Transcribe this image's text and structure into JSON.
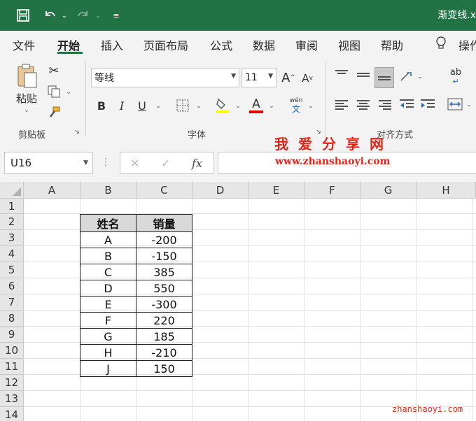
{
  "title_bar": {
    "file_title": "渐变线.x"
  },
  "tabs": [
    "文件",
    "开始",
    "插入",
    "页面布局",
    "公式",
    "数据",
    "审阅",
    "视图",
    "帮助",
    "操作"
  ],
  "active_tab": "开始",
  "ribbon": {
    "clipboard": {
      "paste_label": "粘贴",
      "group_label": "剪贴板"
    },
    "font": {
      "font_name": "等线",
      "font_size": "11",
      "bold": "B",
      "italic": "I",
      "underline": "U",
      "font_color_glyph": "A",
      "phonetic_top": "wén",
      "phonetic_bottom": "文",
      "grow": "A",
      "shrink": "A",
      "group_label": "字体"
    },
    "alignment": {
      "group_label": "对齐方式",
      "wrap_glyph": "ab"
    },
    "colors": {
      "fill_color": "#ffff00",
      "font_color": "#e00000"
    }
  },
  "formula_bar": {
    "name_box": "U16",
    "fx": "fx"
  },
  "watermark": {
    "title": "我爱分享网",
    "url": "www.zhanshaoyi.com",
    "corner": "zhanshaoyi.com"
  },
  "grid": {
    "columns": [
      "A",
      "B",
      "C",
      "D",
      "E",
      "F",
      "G",
      "H"
    ],
    "rows": [
      "1",
      "2",
      "3",
      "4",
      "5",
      "6",
      "7",
      "8",
      "9",
      "10",
      "11",
      "12",
      "13",
      "14"
    ]
  },
  "table": {
    "headers": [
      "姓名",
      "销量"
    ],
    "rows": [
      [
        "A",
        "-200"
      ],
      [
        "B",
        "-150"
      ],
      [
        "C",
        "385"
      ],
      [
        "D",
        "550"
      ],
      [
        "E",
        "-300"
      ],
      [
        "F",
        "220"
      ],
      [
        "G",
        "185"
      ],
      [
        "H",
        "-210"
      ],
      [
        "J",
        "150"
      ]
    ]
  }
}
